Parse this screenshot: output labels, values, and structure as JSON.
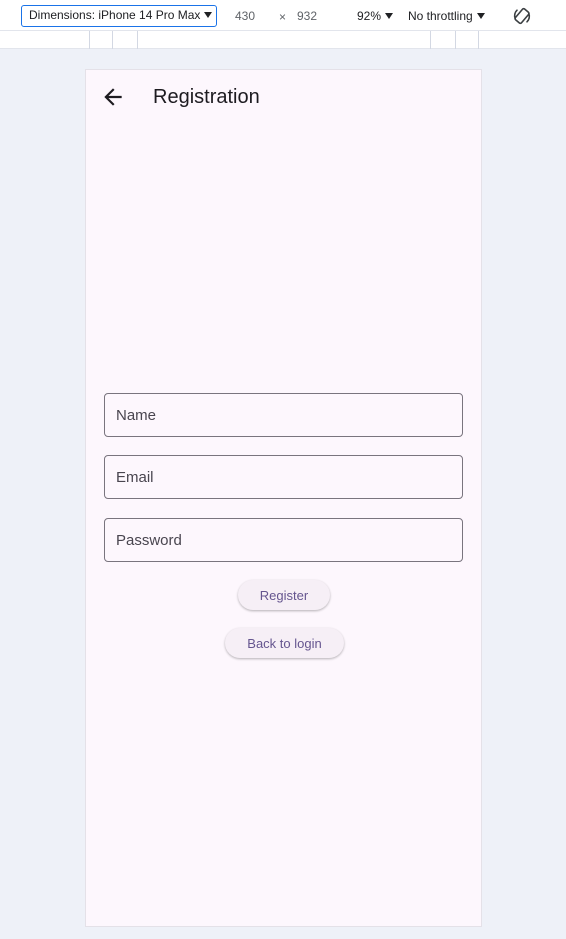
{
  "devtools": {
    "dimensions_label": "Dimensions: iPhone 14 Pro Max",
    "width": "430",
    "times": "×",
    "height": "932",
    "zoom": "92%",
    "throttling": "No throttling",
    "rotate_icon": "rotate-icon"
  },
  "app": {
    "title": "Registration",
    "back_icon": "arrow-left-icon",
    "fields": {
      "name_placeholder": "Name",
      "email_placeholder": "Email",
      "password_placeholder": "Password"
    },
    "buttons": {
      "register": "Register",
      "back_to_login": "Back to login"
    }
  },
  "colors": {
    "accent": "#1a73e8",
    "surface": "#fdf7fd",
    "button_text": "#65558f",
    "outline": "#79747e"
  }
}
